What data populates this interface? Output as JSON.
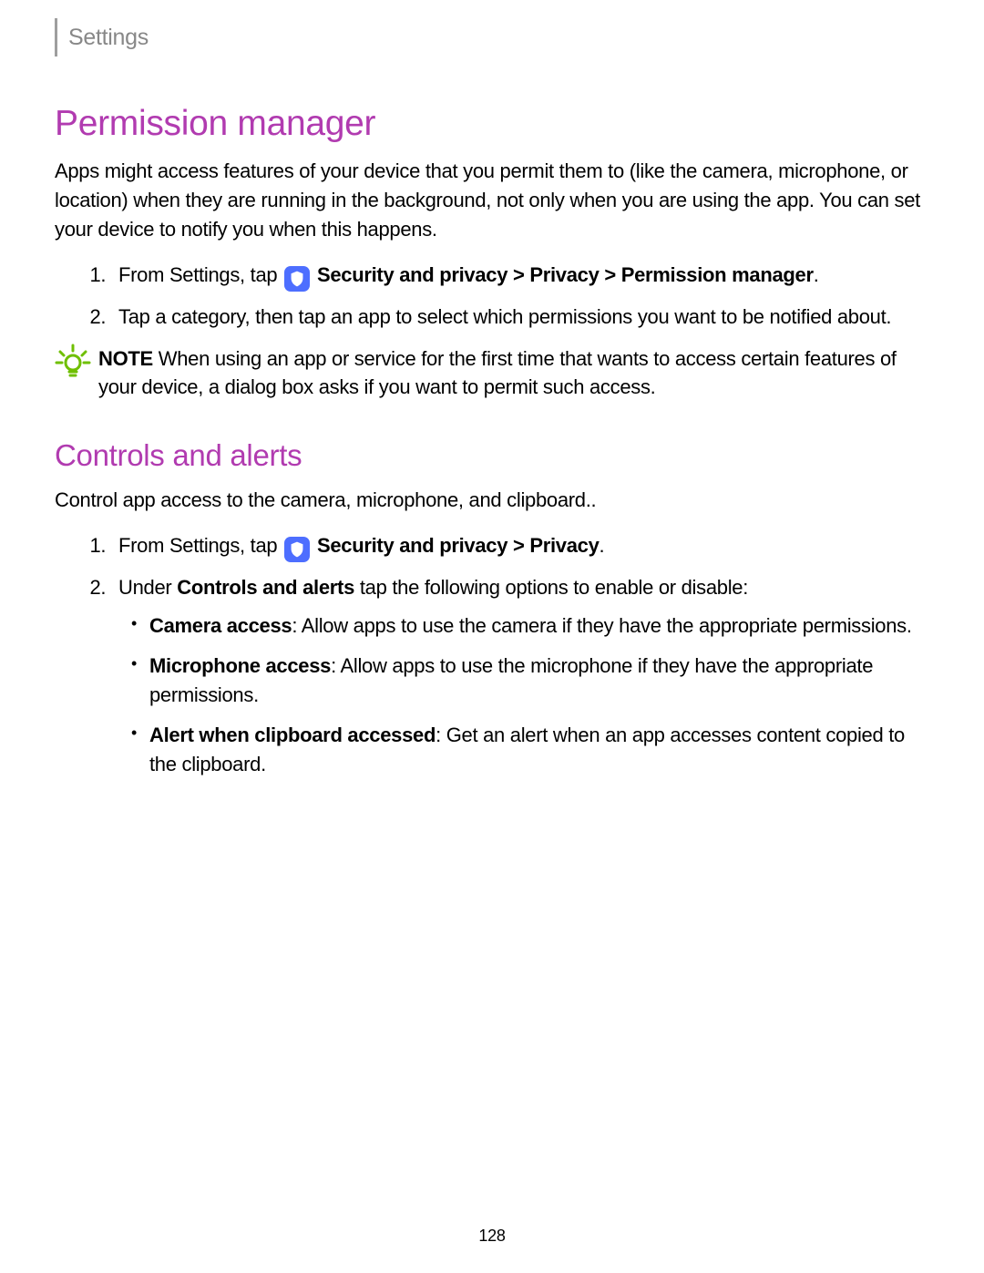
{
  "header": {
    "breadcrumb": "Settings"
  },
  "section1": {
    "title": "Permission manager",
    "intro": "Apps might access features of your device that you permit them to (like the camera, microphone, or location) when they are running in the background, not only when you are using the app. You can set your device to notify you when this happens.",
    "step1_before": "From Settings, tap ",
    "step1_bold": "Security and privacy > Privacy > Permission manager",
    "step1_after": ".",
    "step2": "Tap a category, then tap an app to select which permissions you want to be notified about.",
    "note_label": "NOTE",
    "note_text": "  When using an app or service for the first time that wants to access certain features of your device, a dialog box asks if you want to permit such access."
  },
  "section2": {
    "title": "Controls and alerts",
    "intro": "Control app access to the camera, microphone, and clipboard..",
    "step1_before": "From Settings, tap ",
    "step1_bold": "Security and privacy > Privacy",
    "step1_after": ".",
    "step2_before": "Under ",
    "step2_bold": "Controls and alerts",
    "step2_after": " tap the following options to enable or disable:",
    "bullets": [
      {
        "label": "Camera access",
        "text": ": Allow apps to use the camera if they have the appropriate permissions."
      },
      {
        "label": "Microphone access",
        "text": ": Allow apps to use the microphone if they have the appropriate permissions."
      },
      {
        "label": "Alert when clipboard accessed",
        "text": ": Get an alert when an app accesses content copied to the clipboard."
      }
    ]
  },
  "page_number": "128"
}
